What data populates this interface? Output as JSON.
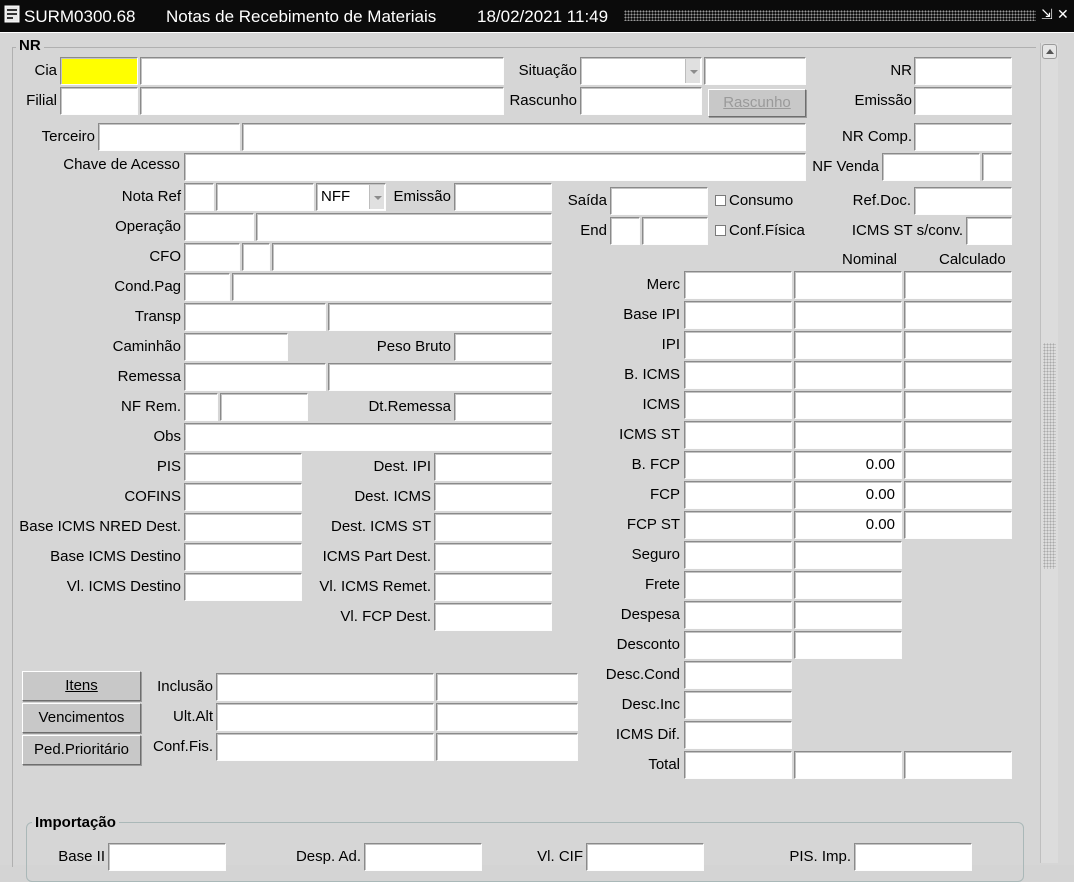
{
  "window": {
    "code": "SURM0300.68",
    "title": "Notas de Recebimento de Materiais",
    "datetime": "18/02/2021 11:49",
    "app_icon": "form-icon",
    "minimize_glyph": "⇲",
    "close_glyph": "✕"
  },
  "colors": {
    "titlebar": "#0b0b0b",
    "required_field": "#ffff00",
    "background": "#d6d6d6"
  },
  "section_nr": {
    "title": "NR"
  },
  "header": {
    "cia_label": "Cia",
    "cia_value": "",
    "cia_desc": "",
    "filial_label": "Filial",
    "filial_value": "",
    "filial_desc": "",
    "situacao_label": "Situação",
    "situacao_value": "",
    "situacao_desc": "",
    "rascunho_label": "Rascunho",
    "rascunho_value": "",
    "rascunho_button": "Rascunho",
    "nr_label": "NR",
    "nr_value": "",
    "emissao_label": "Emissão",
    "emissao_value": "",
    "terceiro_label": "Terceiro",
    "terceiro_value": "",
    "terceiro_desc": "",
    "nr_comp_label": "NR Comp.",
    "nr_comp_value": "",
    "chave_label": "Chave de Acesso",
    "chave_value": "",
    "nf_venda_label": "NF Venda",
    "nf_venda_value": "",
    "nf_venda_extra": ""
  },
  "left": {
    "nota_ref_label": "Nota Ref",
    "nota_ref_a": "",
    "nota_ref_b": "",
    "nota_tipo": "NFF",
    "emissao_label": "Emissão",
    "emissao_value": "",
    "operacao_label": "Operação",
    "operacao_code": "",
    "operacao_desc": "",
    "cfo_label": "CFO",
    "cfo_a": "",
    "cfo_b": "",
    "cfo_desc": "",
    "cond_pag_label": "Cond.Pag",
    "cond_pag_code": "",
    "cond_pag_desc": "",
    "transp_label": "Transp",
    "transp_code": "",
    "transp_desc": "",
    "caminhao_label": "Caminhão",
    "caminhao_value": "",
    "peso_bruto_label": "Peso Bruto",
    "peso_bruto_value": "",
    "remessa_label": "Remessa",
    "remessa_code": "",
    "remessa_desc": "",
    "nf_rem_label": "NF Rem.",
    "nf_rem_a": "",
    "nf_rem_b": "",
    "dt_remessa_label": "Dt.Remessa",
    "dt_remessa_value": "",
    "obs_label": "Obs",
    "obs_value": "",
    "pis_label": "PIS",
    "pis_value": "",
    "cofins_label": "COFINS",
    "cofins_value": "",
    "base_icms_nred_label": "Base ICMS NRED Dest.",
    "base_icms_nred_value": "",
    "base_icms_destino_label": "Base ICMS Destino",
    "base_icms_destino_value": "",
    "vl_icms_destino_label": "Vl. ICMS Destino",
    "vl_icms_destino_value": "",
    "dest_ipi_label": "Dest. IPI",
    "dest_ipi_value": "",
    "dest_icms_label": "Dest. ICMS",
    "dest_icms_value": "",
    "dest_icms_st_label": "Dest. ICMS ST",
    "dest_icms_st_value": "",
    "icms_part_dest_label": "ICMS Part Dest.",
    "icms_part_dest_value": "",
    "vl_icms_remet_label": "Vl. ICMS Remet.",
    "vl_icms_remet_value": "",
    "vl_fcp_dest_label": "Vl. FCP Dest.",
    "vl_fcp_dest_value": ""
  },
  "right_top": {
    "saida_label": "Saída",
    "saida_value": "",
    "end_label": "End",
    "end_a": "",
    "end_b": "",
    "consumo_label": "Consumo",
    "consumo_checked": false,
    "conf_fisica_label": "Conf.Física",
    "conf_fisica_checked": false,
    "ref_doc_label": "Ref.Doc.",
    "ref_doc_value": "",
    "icms_st_sconv_label": "ICMS ST s/conv.",
    "icms_st_sconv_value": ""
  },
  "values": {
    "col_nominal": "Nominal",
    "col_calculado": "Calculado",
    "rows": [
      {
        "label": "Merc",
        "col1": "",
        "col2": "",
        "col3": ""
      },
      {
        "label": "Base IPI",
        "col1": "",
        "col2": "",
        "col3": ""
      },
      {
        "label": "IPI",
        "col1": "",
        "col2": "",
        "col3": ""
      },
      {
        "label": "B. ICMS",
        "col1": "",
        "col2": "",
        "col3": ""
      },
      {
        "label": "ICMS",
        "col1": "",
        "col2": "",
        "col3": ""
      },
      {
        "label": "ICMS ST",
        "col1": "",
        "col2": "",
        "col3": ""
      },
      {
        "label": "B. FCP",
        "col1": "",
        "col2": "0.00",
        "col3": ""
      },
      {
        "label": "FCP",
        "col1": "",
        "col2": "0.00",
        "col3": ""
      },
      {
        "label": "FCP ST",
        "col1": "",
        "col2": "0.00",
        "col3": ""
      },
      {
        "label": "Seguro",
        "col1": "",
        "col2": ""
      },
      {
        "label": "Frete",
        "col1": "",
        "col2": ""
      },
      {
        "label": "Despesa",
        "col1": "",
        "col2": ""
      },
      {
        "label": "Desconto",
        "col1": "",
        "col2": ""
      },
      {
        "label": "Desc.Cond",
        "col1": ""
      },
      {
        "label": "Desc.Inc",
        "col1": ""
      },
      {
        "label": "ICMS Dif.",
        "col1": ""
      },
      {
        "label": "Total",
        "col1": "",
        "col2": "",
        "col3": ""
      }
    ]
  },
  "buttons": {
    "itens": "Itens",
    "vencimentos": "Vencimentos",
    "ped_prioritario": "Ped.Prioritário"
  },
  "audit": {
    "inclusao_label": "Inclusão",
    "inclusao_a": "",
    "inclusao_b": "",
    "ult_alt_label": "Ult.Alt",
    "ult_alt_a": "",
    "ult_alt_b": "",
    "conf_fis_label": "Conf.Fis.",
    "conf_fis_a": "",
    "conf_fis_b": ""
  },
  "importacao": {
    "title": "Importação",
    "base_ii_label": "Base II",
    "base_ii_value": "",
    "desp_ad_label": "Desp. Ad.",
    "desp_ad_value": "",
    "vl_cif_label": "Vl. CIF",
    "vl_cif_value": "",
    "pis_imp_label": "PIS. Imp.",
    "pis_imp_value": ""
  }
}
